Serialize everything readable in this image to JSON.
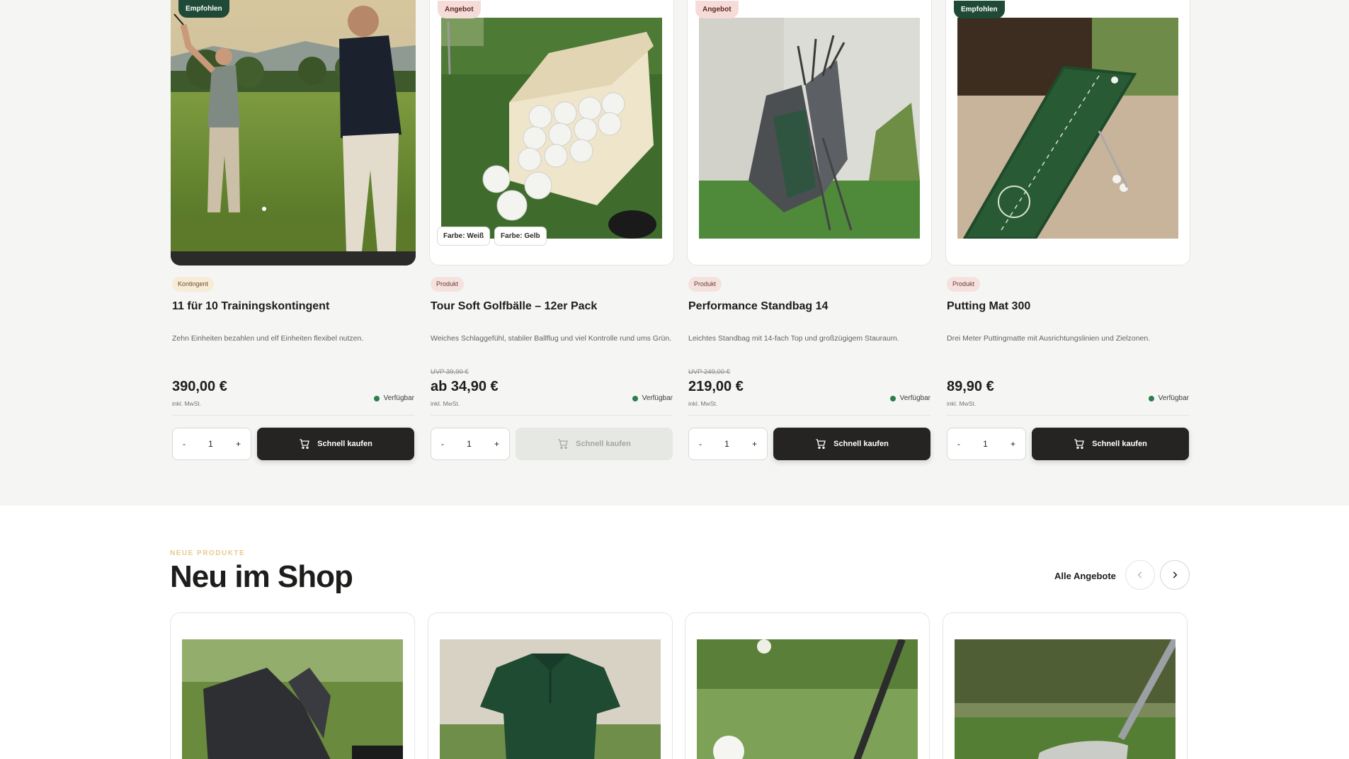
{
  "products": [
    {
      "badge": "Empfohlen",
      "badge_style": "green",
      "type": "Kontingent",
      "type_style": "beige",
      "title": "11 für 10 Trainingskontingent",
      "description": "Zehn Einheiten bezahlen und elf Einheiten flexibel nutzen.",
      "uvp": "",
      "price": "390,00 €",
      "tax": "inkl. MwSt.",
      "stock": "Verfügbar",
      "qty_minus": "-",
      "qty_value": "1",
      "qty_plus": "+",
      "buy_label": "Schnell kaufen",
      "buy_enabled": true,
      "image": "golf-training-photo"
    },
    {
      "badge": "Angebot",
      "badge_style": "pink",
      "type": "Produkt",
      "type_style": "pinkish",
      "title": "Tour Soft Golfbälle – 12er Pack",
      "description": "Weiches Schlaggefühl, stabiler Ballflug und viel Kontrolle rund ums Grün.",
      "uvp": "UVP 39,90 €",
      "price": "ab 34,90 €",
      "tax": "inkl. MwSt.",
      "stock": "Verfügbar",
      "qty_minus": "-",
      "qty_value": "1",
      "qty_plus": "+",
      "buy_label": "Schnell kaufen",
      "buy_enabled": false,
      "variants": [
        "Farbe: Weiß",
        "Farbe: Gelb"
      ],
      "image": "golf-balls-box"
    },
    {
      "badge": "Angebot",
      "badge_style": "pink",
      "type": "Produkt",
      "type_style": "pinkish",
      "title": "Performance Standbag 14",
      "description": "Leichtes Standbag mit 14-fach Top und großzügigem Stauraum.",
      "uvp": "UVP 249,00 €",
      "price": "219,00 €",
      "tax": "inkl. MwSt.",
      "stock": "Verfügbar",
      "qty_minus": "-",
      "qty_value": "1",
      "qty_plus": "+",
      "buy_label": "Schnell kaufen",
      "buy_enabled": true,
      "image": "golf-standbag"
    },
    {
      "badge": "Empfohlen",
      "badge_style": "green",
      "type": "Produkt",
      "type_style": "pinkish",
      "title": "Putting Mat 300",
      "description": "Drei Meter Puttingmatte mit Ausrichtungslinien und Zielzonen.",
      "uvp": "",
      "price": "89,90 €",
      "tax": "inkl. MwSt.",
      "stock": "Verfügbar",
      "qty_minus": "-",
      "qty_value": "1",
      "qty_plus": "+",
      "buy_label": "Schnell kaufen",
      "buy_enabled": true,
      "image": "putting-mat"
    }
  ],
  "new_section": {
    "eyebrow": "NEUE PRODUKTE",
    "title": "Neu im Shop",
    "all_link": "Alle Angebote",
    "prev_icon": "chevron-left-icon",
    "next_icon": "chevron-right-icon",
    "cards": [
      "golf-glove",
      "golf-polo-shirt",
      "golf-ball-and-club",
      "golf-wedge"
    ]
  },
  "colors": {
    "accent_dark": "#262422",
    "brand_green": "#1f4a37",
    "stock_green": "#2e7d4f",
    "eyebrow_gold": "#e9c98f"
  }
}
